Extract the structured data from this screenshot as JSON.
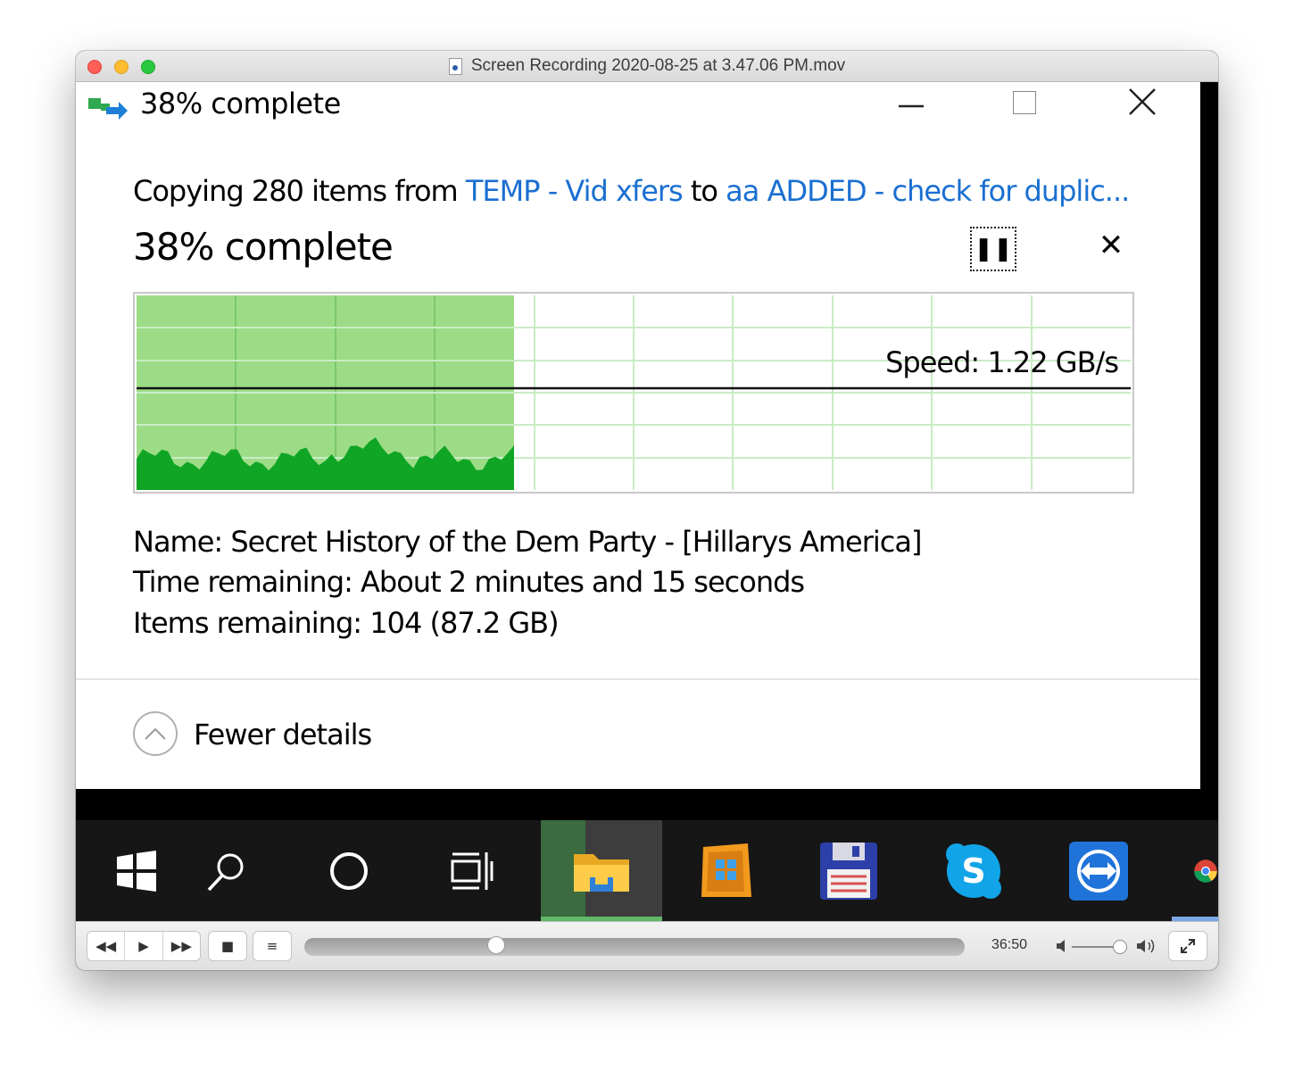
{
  "window": {
    "title": "Screen Recording 2020-08-25 at 3.47.06 PM.mov"
  },
  "dialog": {
    "title": "38% complete",
    "copy_prefix": "Copying 280 items from ",
    "source": "TEMP - Vid xfers",
    "copy_middle": " to ",
    "destination": "aa ADDED - check for duplic...",
    "percent_label": "38% complete",
    "progress_fraction": 0.38,
    "speed": "Speed: 1.22 GB/s",
    "name_line": "Name:  Secret History of the Dem Party - [Hillarys America]",
    "time_line": "Time remaining:  About 2 minutes and 15 seconds",
    "items_line": "Items remaining:  104 (87.2 GB)",
    "fewer_details": "Fewer details",
    "colors": {
      "link": "#1a6fd1",
      "graph_fill": "#9cdc86",
      "graph_area": "#10a524"
    }
  },
  "taskbar": {
    "items": [
      "windows-start-icon",
      "search-icon",
      "cortana-icon",
      "task-view-icon",
      "file-explorer-icon",
      "windows-store-icon",
      "save-floppy-icon",
      "skype-icon",
      "teamviewer-icon",
      "chrome-icon"
    ]
  },
  "player": {
    "timecode": "36:50",
    "playback_fraction": 0.29,
    "volume_fraction": 0.9
  }
}
